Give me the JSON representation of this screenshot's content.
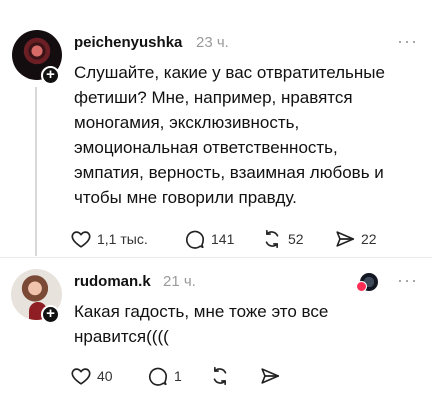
{
  "posts": [
    {
      "username": "peichenyushka",
      "time": "23 ч.",
      "text_lines": [
        "Слушайте, какие у вас отвратительные",
        "фетиши? Мне, например, нравятся",
        "моногамия, эксклюзивность,",
        "эмоциональная ответственность,",
        "эмпатия, верность, взаимная любовь и",
        "чтобы мне говорили правду."
      ],
      "counts": {
        "likes": "1,1 тыс.",
        "replies": "141",
        "reposts": "52",
        "shares": "22"
      },
      "more_label": "···"
    },
    {
      "username": "rudoman.k",
      "time": "21 ч.",
      "text_lines": [
        "Какая гадость, мне тоже это все",
        "нравится(((("
      ],
      "counts": {
        "likes": "40",
        "replies": "1"
      },
      "more_label": "···"
    }
  ],
  "icons": {
    "like": "heart-icon",
    "reply": "comment-icon",
    "repost": "repost-icon",
    "share": "send-icon",
    "more": "more-icon"
  }
}
